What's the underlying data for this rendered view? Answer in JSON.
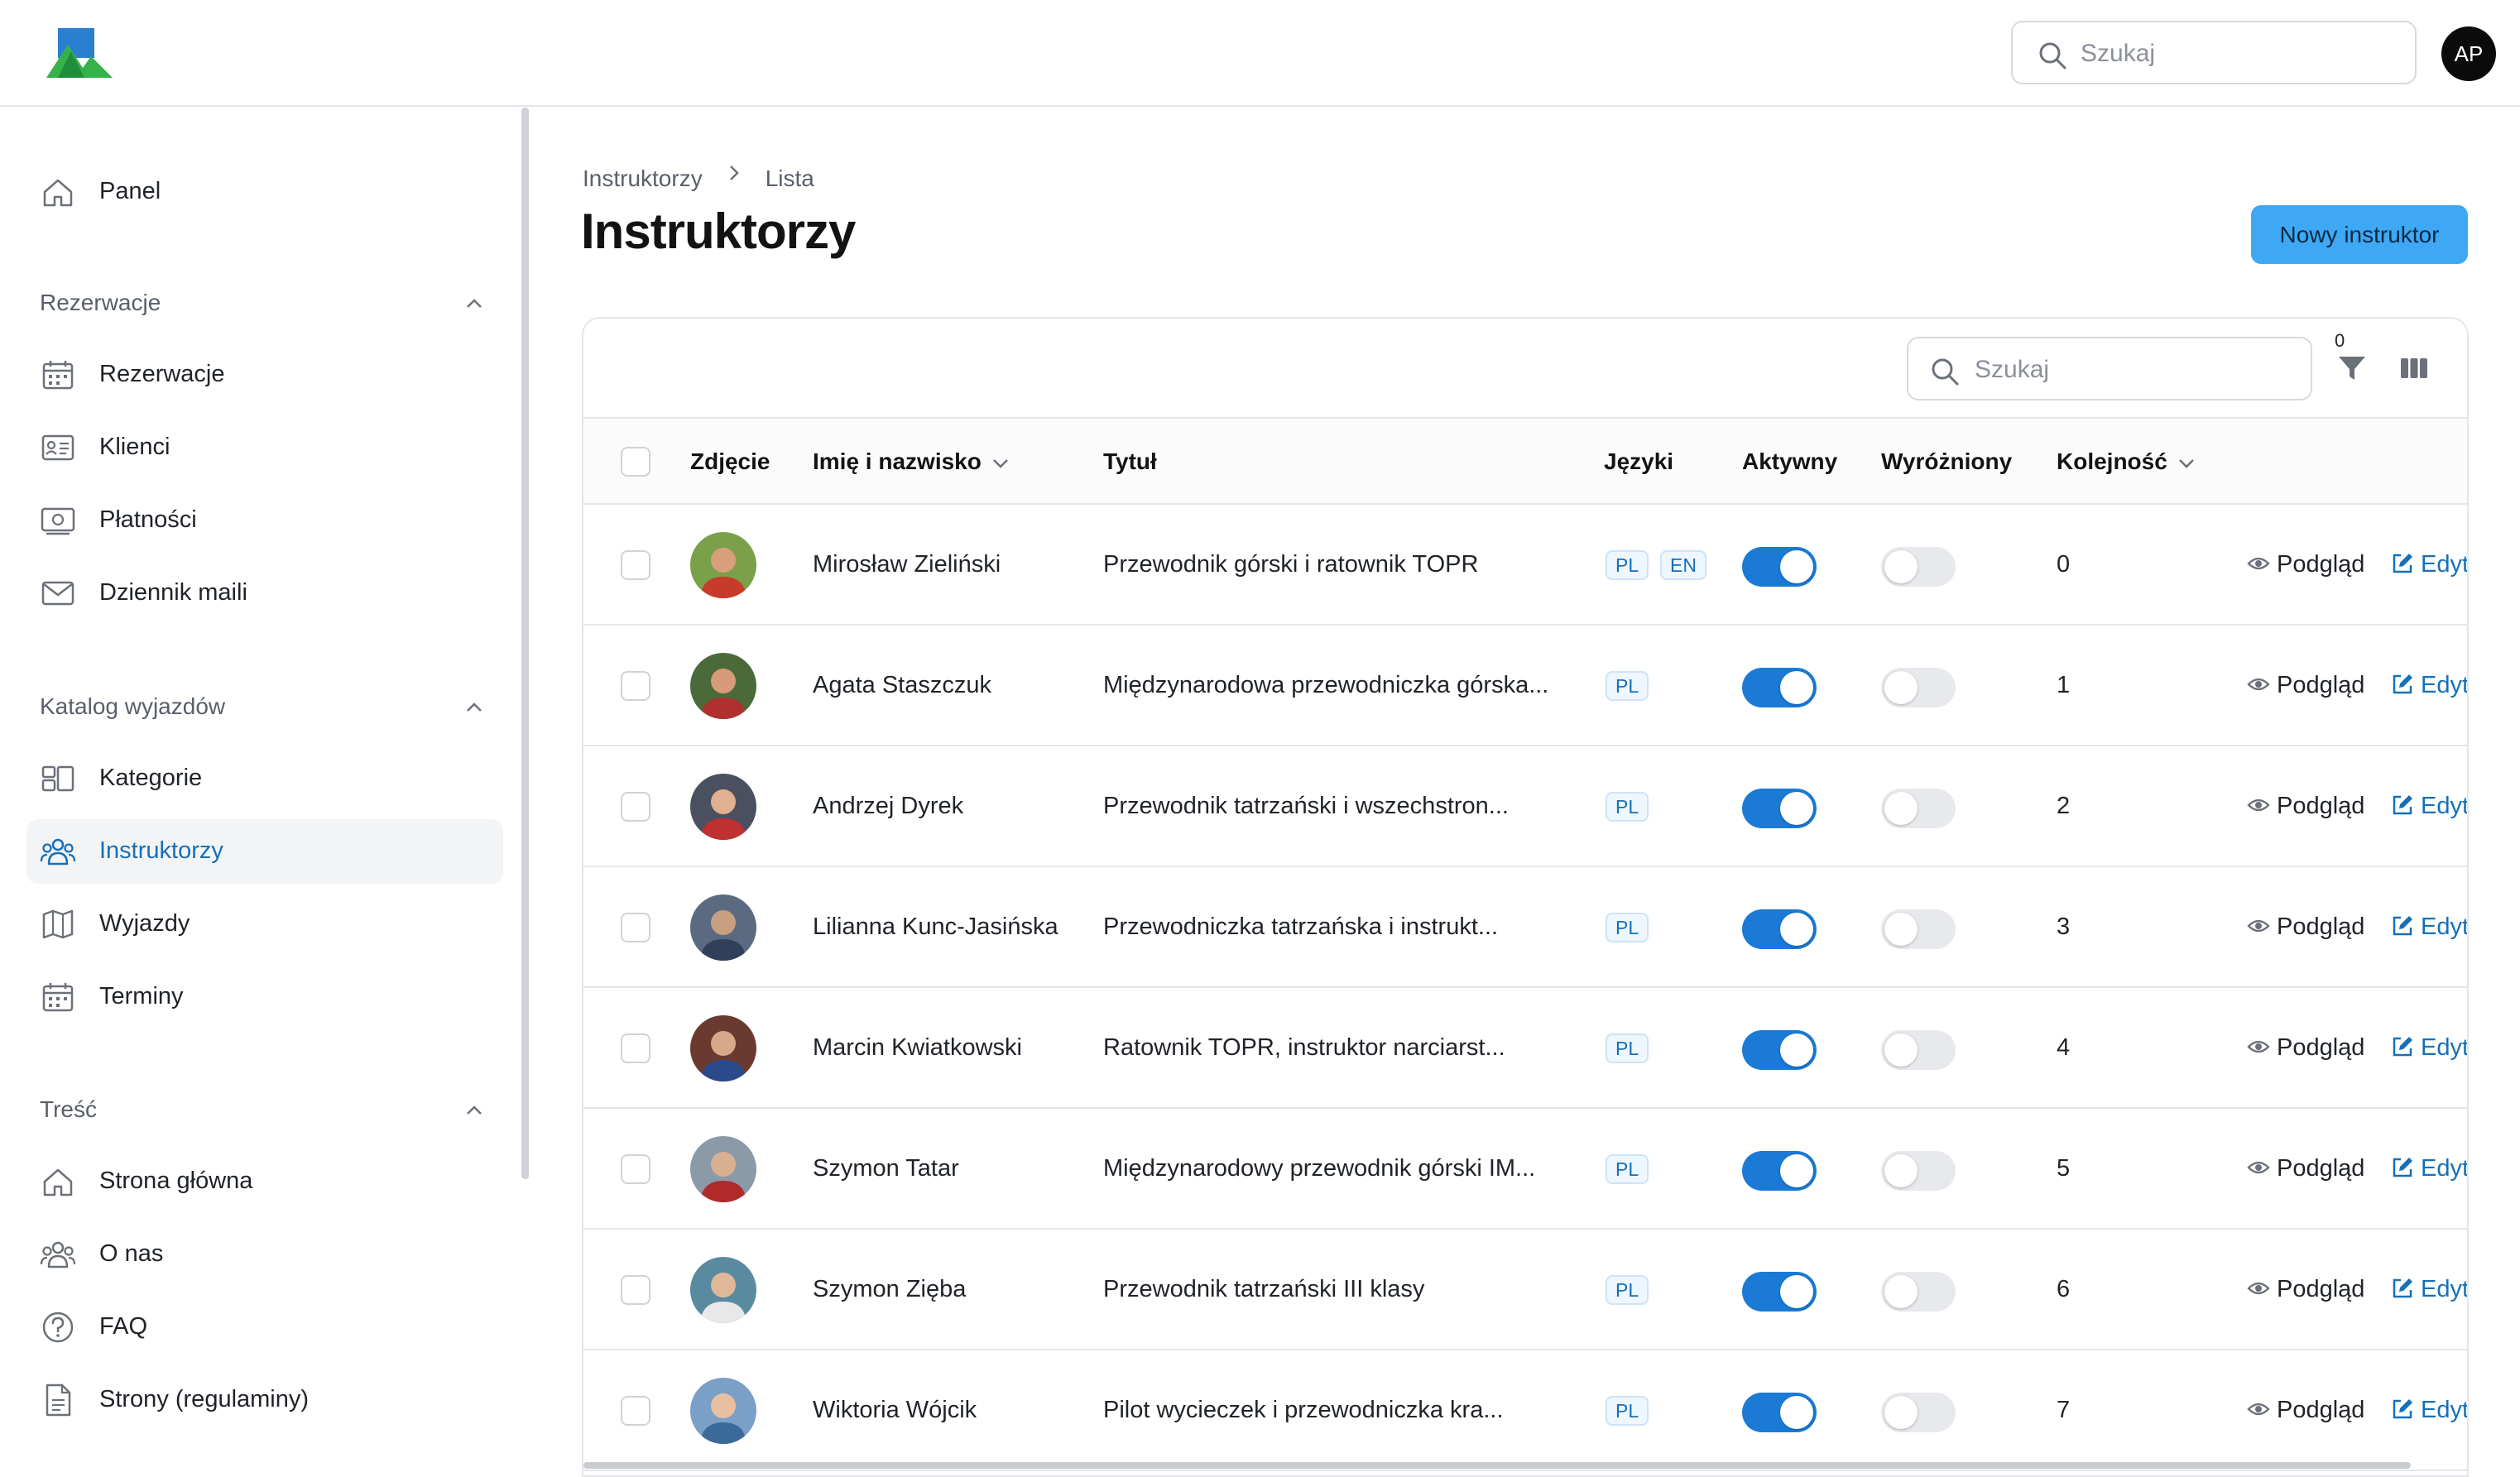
{
  "header": {
    "search_placeholder": "Szukaj",
    "user_initials": "AP"
  },
  "sidebar": {
    "top_item": {
      "label": "Panel",
      "icon": "home-icon"
    },
    "groups": [
      {
        "label": "Rezerwacje",
        "items": [
          {
            "label": "Rezerwacje",
            "icon": "calendar-icon"
          },
          {
            "label": "Klienci",
            "icon": "id-card-icon"
          },
          {
            "label": "Płatności",
            "icon": "banknote-icon"
          },
          {
            "label": "Dziennik maili",
            "icon": "envelope-icon"
          }
        ]
      },
      {
        "label": "Katalog wyjazdów",
        "items": [
          {
            "label": "Kategorie",
            "icon": "grid-icon"
          },
          {
            "label": "Instruktorzy",
            "icon": "users-icon",
            "active": true
          },
          {
            "label": "Wyjazdy",
            "icon": "map-icon"
          },
          {
            "label": "Terminy",
            "icon": "calendar-icon"
          }
        ]
      },
      {
        "label": "Treść",
        "items": [
          {
            "label": "Strona główna",
            "icon": "home-icon"
          },
          {
            "label": "O nas",
            "icon": "users-icon"
          },
          {
            "label": "FAQ",
            "icon": "question-circle-icon"
          },
          {
            "label": "Strony (regulaminy)",
            "icon": "document-icon"
          }
        ]
      }
    ]
  },
  "breadcrumb": [
    "Instruktorzy",
    "Lista"
  ],
  "page_title": "Instruktorzy",
  "new_button_label": "Nowy instruktor",
  "table": {
    "search_placeholder": "Szukaj",
    "filter_count": "0",
    "columns": {
      "photo": "Zdjęcie",
      "name": "Imię i nazwisko",
      "title": "Tytuł",
      "languages": "Języki",
      "active": "Aktywny",
      "featured": "Wyróżniony",
      "order": "Kolejność"
    },
    "actions": {
      "view": "Podgląd",
      "edit": "Edyt"
    },
    "rows": [
      {
        "name": "Mirosław Zieliński",
        "title": "Przewodnik górski i ratownik TOPR",
        "languages": [
          "PL",
          "EN"
        ],
        "active": true,
        "featured": false,
        "order": "0"
      },
      {
        "name": "Agata Staszczuk",
        "title": "Międzynarodowa przewodniczka górska...",
        "languages": [
          "PL"
        ],
        "active": true,
        "featured": false,
        "order": "1"
      },
      {
        "name": "Andrzej Dyrek",
        "title": "Przewodnik tatrzański i wszechstron...",
        "languages": [
          "PL"
        ],
        "active": true,
        "featured": false,
        "order": "2"
      },
      {
        "name": "Lilianna Kunc-Jasińska",
        "title": "Przewodniczka tatrzańska i instrukt...",
        "languages": [
          "PL"
        ],
        "active": true,
        "featured": false,
        "order": "3"
      },
      {
        "name": "Marcin Kwiatkowski",
        "title": "Ratownik TOPR, instruktor narciarst...",
        "languages": [
          "PL"
        ],
        "active": true,
        "featured": false,
        "order": "4"
      },
      {
        "name": "Szymon Tatar",
        "title": "Międzynarodowy przewodnik górski IM...",
        "languages": [
          "PL"
        ],
        "active": true,
        "featured": false,
        "order": "5"
      },
      {
        "name": "Szymon Zięba",
        "title": "Przewodnik tatrzański III klasy",
        "languages": [
          "PL"
        ],
        "active": true,
        "featured": false,
        "order": "6"
      },
      {
        "name": "Wiktoria Wójcik",
        "title": "Pilot wycieczek i przewodniczka kra...",
        "languages": [
          "PL"
        ],
        "active": true,
        "featured": false,
        "order": "7"
      }
    ]
  },
  "colors": {
    "accent": "#1670b8",
    "primary_button": "#3ea8f5",
    "toggle_on": "#1a7ad6",
    "toggle_off": "#e8e9ec"
  }
}
